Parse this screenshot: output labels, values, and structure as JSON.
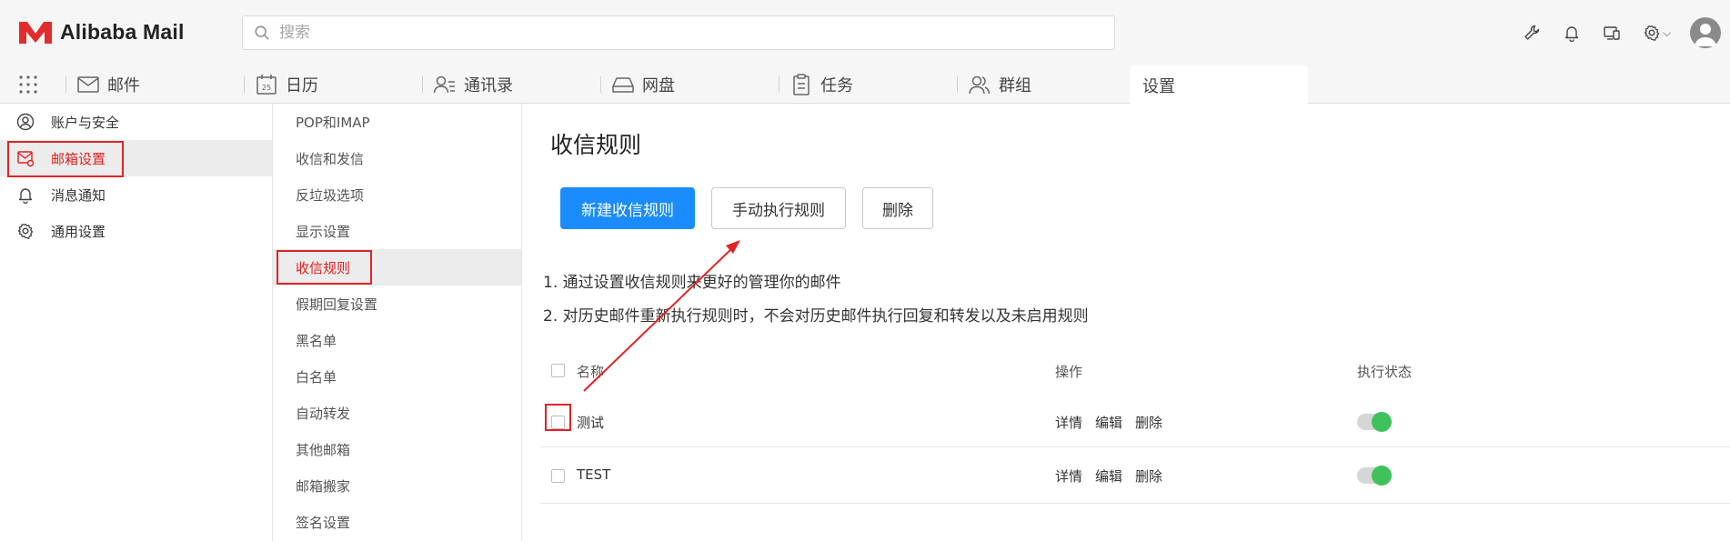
{
  "app": {
    "brand": "Alibaba Mail"
  },
  "search": {
    "placeholder": "搜索"
  },
  "topbar_icons": [
    "wrench-icon",
    "bell-icon",
    "devices-icon",
    "gear-icon",
    "avatar"
  ],
  "nav": {
    "tabs": [
      {
        "label": "邮件",
        "icon": "mail-icon"
      },
      {
        "label": "日历",
        "icon": "calendar-icon",
        "icon_text": "25"
      },
      {
        "label": "通讯录",
        "icon": "contacts-icon"
      },
      {
        "label": "网盘",
        "icon": "drive-icon"
      },
      {
        "label": "任务",
        "icon": "task-icon"
      },
      {
        "label": "群组",
        "icon": "group-icon"
      },
      {
        "label": "设置",
        "active": true
      }
    ]
  },
  "sidebar": {
    "items": [
      {
        "label": "账户与安全",
        "icon": "user-circle-icon"
      },
      {
        "label": "邮箱设置",
        "icon": "mailbox-settings-icon",
        "selected": true
      },
      {
        "label": "消息通知",
        "icon": "bell-icon"
      },
      {
        "label": "通用设置",
        "icon": "gear-icon"
      }
    ]
  },
  "subnav": {
    "items": [
      {
        "label": "POP和IMAP"
      },
      {
        "label": "收信和发信"
      },
      {
        "label": "反垃圾选项"
      },
      {
        "label": "显示设置"
      },
      {
        "label": "收信规则",
        "selected": true
      },
      {
        "label": "假期回复设置"
      },
      {
        "label": "黑名单"
      },
      {
        "label": "白名单"
      },
      {
        "label": "自动转发"
      },
      {
        "label": "其他邮箱"
      },
      {
        "label": "邮箱搬家"
      },
      {
        "label": "签名设置"
      }
    ]
  },
  "main": {
    "title": "收信规则",
    "buttons": {
      "new_rule": "新建收信规则",
      "run_manually": "手动执行规则",
      "delete": "删除"
    },
    "tips": [
      "1. 通过设置收信规则来更好的管理你的邮件",
      "2. 对历史邮件重新执行规则时，不会对历史邮件执行回复和转发以及未启用规则"
    ],
    "table": {
      "headers": {
        "name": "名称",
        "actions": "操作",
        "status": "执行状态"
      },
      "rows": [
        {
          "name": "测试",
          "actions": [
            "详情",
            "编辑",
            "删除"
          ],
          "enabled": true
        },
        {
          "name": "TEST",
          "actions": [
            "详情",
            "编辑",
            "删除"
          ],
          "enabled": true
        }
      ]
    }
  },
  "colors": {
    "accent": "#1a8cff",
    "highlight_red": "#e02424",
    "toggle_on": "#3fc25a",
    "topbar_bg": "#f6f6f6"
  }
}
